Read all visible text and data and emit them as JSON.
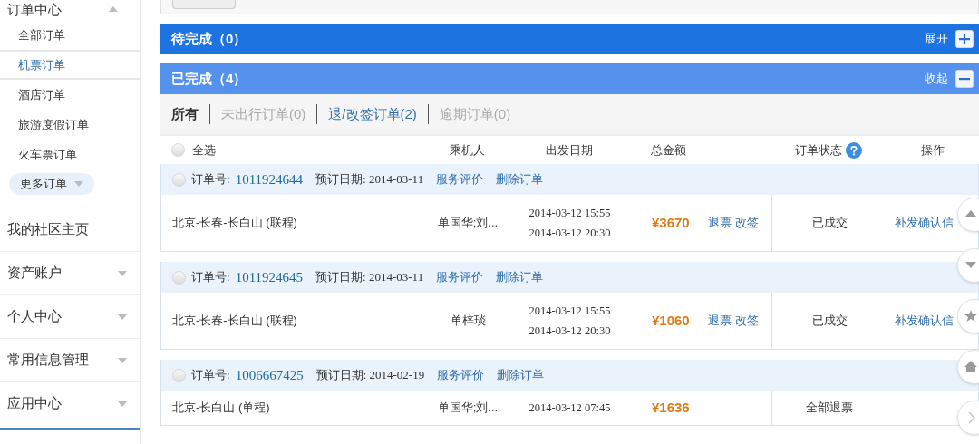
{
  "sidebar": {
    "heading": "订单中心",
    "items": [
      {
        "label": "全部订单",
        "selected": false
      },
      {
        "label": "机票订单",
        "selected": true
      },
      {
        "label": "酒店订单",
        "selected": false
      },
      {
        "label": "旅游度假订单",
        "selected": false
      },
      {
        "label": "火车票订单",
        "selected": false
      }
    ],
    "more": "更多订单",
    "sections": [
      {
        "label": "我的社区主页",
        "expandable": false
      },
      {
        "label": "资产账户",
        "expandable": true
      },
      {
        "label": "个人中心",
        "expandable": true
      },
      {
        "label": "常用信息管理",
        "expandable": true
      },
      {
        "label": "应用中心",
        "expandable": true
      }
    ]
  },
  "panels": [
    {
      "title": "待完成（0）",
      "toggle": "展开",
      "expanded": false
    },
    {
      "title": "已完成（4）",
      "toggle": "收起",
      "expanded": true
    }
  ],
  "filters": [
    {
      "label": "所有",
      "selected": true,
      "disabled": false
    },
    {
      "label": "未出行订单(0)",
      "selected": false,
      "disabled": true
    },
    {
      "label": "退/改签订单(2)",
      "selected": false,
      "disabled": false
    },
    {
      "label": "逾期订单(0)",
      "selected": false,
      "disabled": true
    }
  ],
  "table": {
    "select_all": "全选",
    "select_all_checked": false,
    "columns": [
      "乘机人",
      "出发日期",
      "总金额",
      "订单状态",
      "操作"
    ],
    "orders": [
      {
        "checked": false,
        "order_label": "订单号:",
        "order_no": "1011924644",
        "booking_label": "预订日期:",
        "booking_date": "2014-03-11",
        "links": [
          "服务评价",
          "删除订单"
        ],
        "route": "北京-长春-长白山 (联程)",
        "passenger": "单国华;刘...",
        "dates": [
          "2014-03-12 15:55",
          "2014-03-12 20:30"
        ],
        "price": "¥3670",
        "actions": [
          "退票",
          "改签"
        ],
        "status": "已成交",
        "operation": "补发确认信"
      },
      {
        "checked": false,
        "order_label": "订单号:",
        "order_no": "1011924645",
        "booking_label": "预订日期:",
        "booking_date": "2014-03-11",
        "links": [
          "服务评价",
          "删除订单"
        ],
        "route": "北京-长春-长白山 (联程)",
        "passenger": "单梓琰",
        "dates": [
          "2014-03-12 15:55",
          "2014-03-12 20:30"
        ],
        "price": "¥1060",
        "actions": [
          "退票",
          "改签"
        ],
        "status": "已成交",
        "operation": "补发确认信"
      },
      {
        "checked": false,
        "order_label": "订单号:",
        "order_no": "1006667425",
        "booking_label": "预订日期:",
        "booking_date": "2014-02-19",
        "links": [
          "服务评价",
          "删除订单"
        ],
        "route": "北京-长白山 (单程)",
        "passenger": "单国华;刘...",
        "dates": [
          "2014-03-12 07:45"
        ],
        "price": "¥1636",
        "status": "全部退票"
      }
    ]
  }
}
